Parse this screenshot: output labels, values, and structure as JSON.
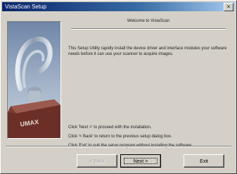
{
  "window": {
    "title": "VistaScan Setup",
    "close_glyph": "×"
  },
  "image": {
    "description_icon": "scanner-sculpture",
    "plinth_text": "UMAX"
  },
  "content": {
    "welcome": "Welcome to VistaScan",
    "intro": "This Setup Utility rapidly install the device driver and interface modules your software needs before it can use your scanner to acquire images.",
    "next_hint": "Click 'Next >' to proceed with the installation.",
    "back_hint": "Click '< Back' to return to the previous setup dialog box.",
    "exit_hint": "Click 'Exit' to quit the setup program without installing the software."
  },
  "buttons": {
    "back": "< Back",
    "next": "Next >",
    "exit": "Exit"
  }
}
